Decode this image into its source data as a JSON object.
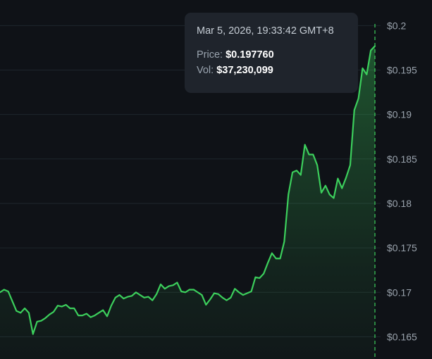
{
  "tooltip": {
    "timestamp": "Mar 5, 2026, 19:33:42 GMT+8",
    "price_label": "Price:",
    "price_value": "$0.197760",
    "vol_label": "Vol:",
    "vol_value": "$37,230,099"
  },
  "colors": {
    "background": "#0f1217",
    "line": "#3ccf5c",
    "grid": "#1f262d",
    "tooltip_bg": "#1f242c",
    "axis_text": "#9aa3ad"
  },
  "chart_data": {
    "type": "area",
    "title": "",
    "xlabel": "",
    "ylabel": "",
    "ylim": [
      0.1625,
      0.2005
    ],
    "y_ticks": [
      "$0.2",
      "$0.195",
      "$0.19",
      "$0.185",
      "$0.18",
      "$0.175",
      "$0.17",
      "$0.165"
    ],
    "y_tick_values": [
      0.2,
      0.195,
      0.19,
      0.185,
      0.18,
      0.175,
      0.17,
      0.165
    ],
    "grid": true,
    "crosshair_index": 124,
    "series": [
      {
        "values": [
          0.17,
          0.1703,
          0.1701,
          0.169,
          0.1679,
          0.1677,
          0.1682,
          0.1677,
          0.1653,
          0.1667,
          0.1668,
          0.1671,
          0.1675,
          0.1678,
          0.1685,
          0.1684,
          0.1686,
          0.1682,
          0.1682,
          0.1674,
          0.1674,
          0.1676,
          0.1672,
          0.1674,
          0.1677,
          0.168,
          0.1673,
          0.1685,
          0.1694,
          0.1697,
          0.1693,
          0.1695,
          0.1696,
          0.17,
          0.1697,
          0.1694,
          0.1695,
          0.1691,
          0.1698,
          0.1709,
          0.1704,
          0.1707,
          0.1708,
          0.1711,
          0.1701,
          0.17,
          0.1703,
          0.1703,
          0.17,
          0.1697,
          0.1686,
          0.1692,
          0.1699,
          0.1698,
          0.1694,
          0.1691,
          0.1694,
          0.1704,
          0.17,
          0.1697,
          0.1699,
          0.1701,
          0.1717,
          0.1716,
          0.1721,
          0.1733,
          0.1744,
          0.1738,
          0.1738,
          0.1757,
          0.181,
          0.1835,
          0.1837,
          0.1832,
          0.1866,
          0.1855,
          0.1855,
          0.1843,
          0.1812,
          0.182,
          0.181,
          0.1806,
          0.1828,
          0.1817,
          0.1829,
          0.1843,
          0.1905,
          0.1918,
          0.1952,
          0.1945,
          0.1972,
          0.1977
        ]
      }
    ]
  }
}
